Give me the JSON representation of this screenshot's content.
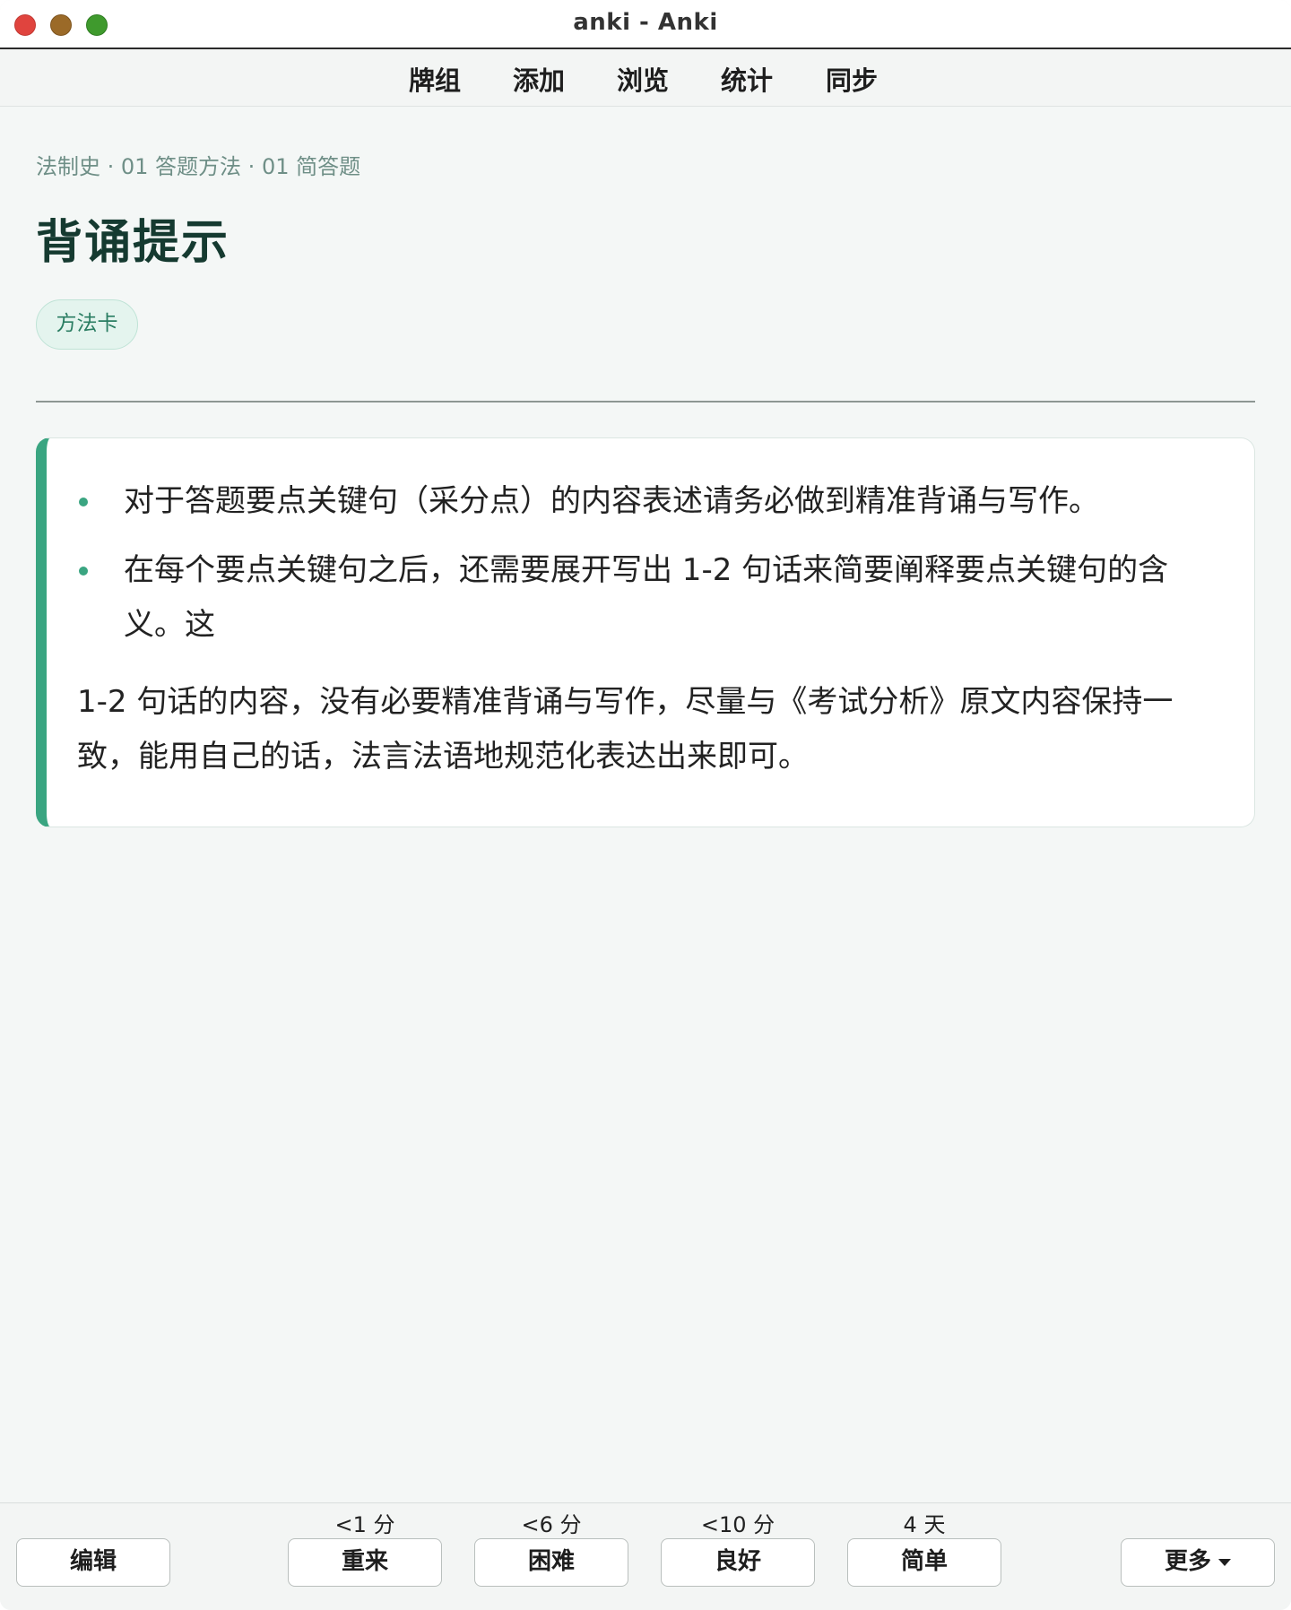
{
  "window": {
    "title": "anki - Anki"
  },
  "toolbar": {
    "items": [
      {
        "label": "牌组"
      },
      {
        "label": "添加"
      },
      {
        "label": "浏览"
      },
      {
        "label": "统计"
      },
      {
        "label": "同步"
      }
    ]
  },
  "card": {
    "breadcrumb": "法制史 · 01 答题方法 · 01 简答题",
    "heading": "背诵提示",
    "tag": "方法卡",
    "bullets": [
      "对于答题要点关键句（采分点）的内容表述请务必做到精准背诵与写作。",
      "在每个要点关键句之后，还需要展开写出 1-2 句话来简要阐释要点关键句的含义。这"
    ],
    "paragraph": "1-2 句话的内容，没有必要精准背诵与写作，尽量与《考试分析》原文内容保持一致，能用自己的话，法言法语地规范化表达出来即可。"
  },
  "answer_bar": {
    "edit_label": "编辑",
    "more_label": "更多",
    "buttons": [
      {
        "interval": "<1 分",
        "label": "重来"
      },
      {
        "interval": "<6 分",
        "label": "困难"
      },
      {
        "interval": "<10 分",
        "label": "良好"
      },
      {
        "interval": "4 天",
        "label": "简单"
      }
    ]
  },
  "colors": {
    "accent": "#3aa581",
    "heading": "#153a30",
    "tag_bg": "#e4f4ee",
    "page_bg": "#f4f7f6"
  }
}
